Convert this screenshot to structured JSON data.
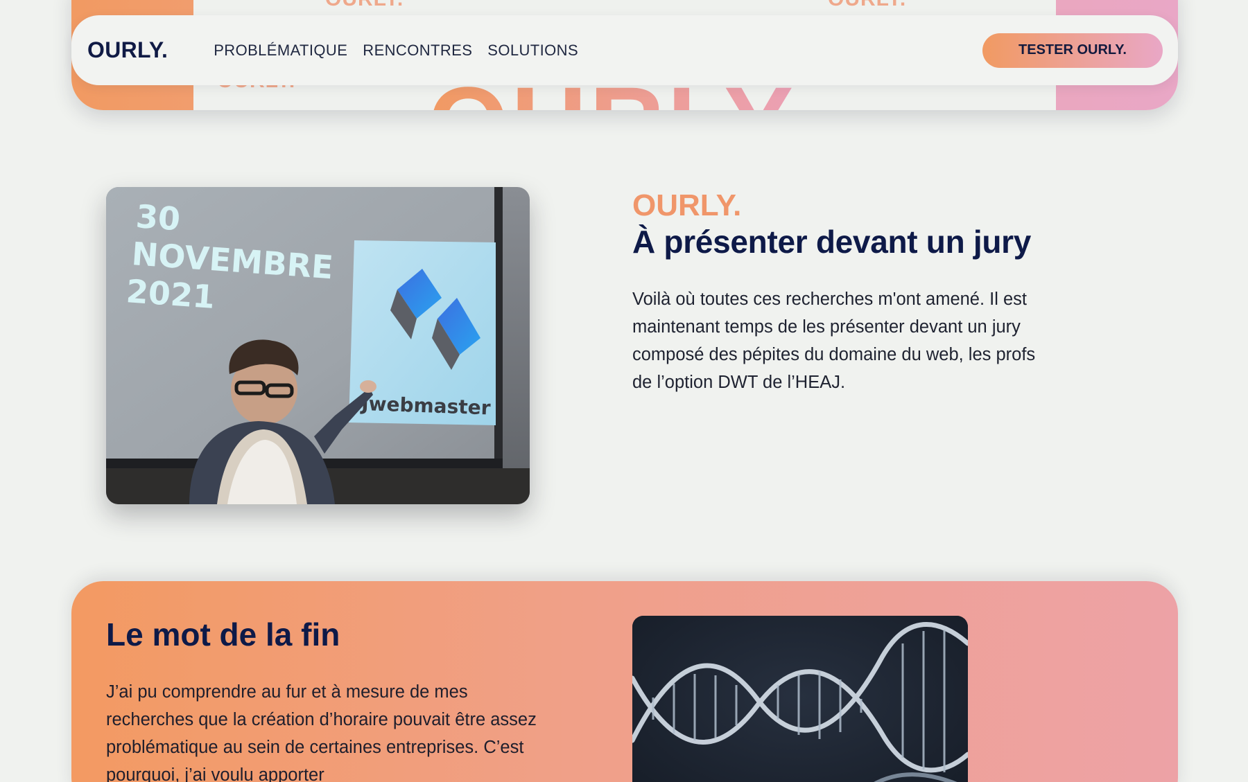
{
  "hero": {
    "ghost_small_1": "OURLY.",
    "ghost_small_2": "OURLY.",
    "ghost_small_3": "OURLY.",
    "ghost_big": "OURLY"
  },
  "nav": {
    "logo": "OURLY.",
    "links": [
      "PROBLÉMATIQUE",
      "RENCONTRES",
      "SOLUTIONS"
    ],
    "cta": "TESTER OURLY."
  },
  "jury": {
    "photo": {
      "date_line1": "30",
      "date_line2": "NOVEMBRE",
      "date_line3": "2021",
      "brand": "Jwebmaster"
    },
    "kicker": "OURLY.",
    "title": "À présenter devant un jury",
    "text": "Voilà où toutes ces recherches m'ont amené. Il est maintenant temps de les présenter devant un jury composé des pépites du domaine du web, les profs de l’option DWT de l’HEAJ."
  },
  "final": {
    "title": "Le mot de la fin",
    "text": "J’ai pu comprendre au fur et à mesure de mes recherches que la création d’horaire pouvait être assez problématique au sein de certaines entreprises. C’est pourquoi, j’ai voulu apporter"
  },
  "colors": {
    "background": "#f0f2ef",
    "navy": "#0e1a48",
    "orange": "#f19a62",
    "pink": "#e9a7c6"
  }
}
